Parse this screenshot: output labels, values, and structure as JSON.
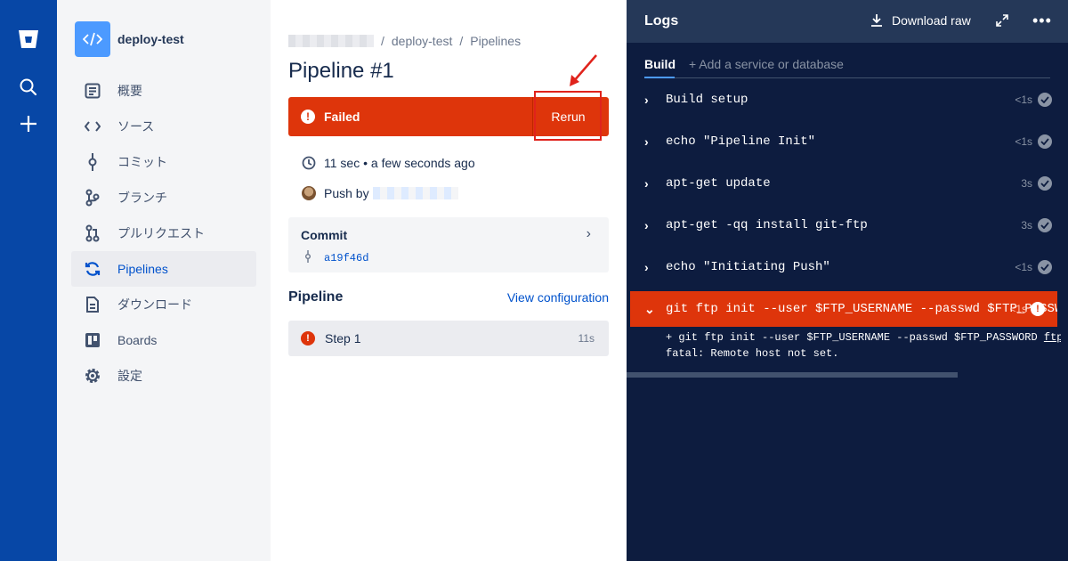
{
  "global_nav": {
    "icons": [
      "bitbucket-logo",
      "search-icon",
      "plus-icon"
    ]
  },
  "sidebar": {
    "project_name": "deploy-test",
    "items": [
      {
        "label": "概要",
        "icon": "overview-icon"
      },
      {
        "label": "ソース",
        "icon": "code-icon"
      },
      {
        "label": "コミット",
        "icon": "commit-icon"
      },
      {
        "label": "ブランチ",
        "icon": "branch-icon"
      },
      {
        "label": "プルリクエスト",
        "icon": "pull-request-icon"
      },
      {
        "label": "Pipelines",
        "icon": "pipelines-icon",
        "active": true
      },
      {
        "label": "ダウンロード",
        "icon": "download-icon"
      },
      {
        "label": "Boards",
        "icon": "boards-icon"
      },
      {
        "label": "設定",
        "icon": "settings-icon"
      }
    ]
  },
  "main": {
    "breadcrumb": [
      "deploy-test",
      "Pipelines"
    ],
    "breadcrumb_sep": "/",
    "title": "Pipeline #1",
    "status": {
      "label": "Failed",
      "icon": "!"
    },
    "rerun_label": "Rerun",
    "duration_text": "11 sec • a few seconds ago",
    "push_by_label": "Push by",
    "commit": {
      "label": "Commit",
      "hash": "a19f46d",
      "chevron": "›"
    },
    "pipeline_label": "Pipeline",
    "view_configuration": "View configuration",
    "step": {
      "label": "Step 1",
      "duration": "11s",
      "icon": "!"
    }
  },
  "logs": {
    "title": "Logs",
    "download_raw": "Download raw",
    "more": "•••",
    "tab_build": "Build",
    "add_service": "+ Add a service or database",
    "rows": [
      {
        "cmd": "Build setup",
        "duration": "<1s",
        "status": "success"
      },
      {
        "cmd": "echo \"Pipeline Init\"",
        "duration": "<1s",
        "status": "success"
      },
      {
        "cmd": "apt-get update",
        "duration": "3s",
        "status": "success"
      },
      {
        "cmd": "apt-get -qq install git-ftp",
        "duration": "3s",
        "status": "success"
      },
      {
        "cmd": "echo \"Initiating Push\"",
        "duration": "<1s",
        "status": "success"
      },
      {
        "cmd": "git ftp init --user $FTP_USERNAME --passwd $FTP_PASSW",
        "duration": "<1s",
        "status": "failed"
      }
    ],
    "output": {
      "line1_prefix": "+ git ftp init --user $FTP_USERNAME --passwd $FTP_PASSWORD ",
      "line1_link": "ftp",
      "line2": "fatal: Remote host not set."
    },
    "colors": {
      "failed": "#de350b",
      "background": "#0d1c3f"
    }
  }
}
